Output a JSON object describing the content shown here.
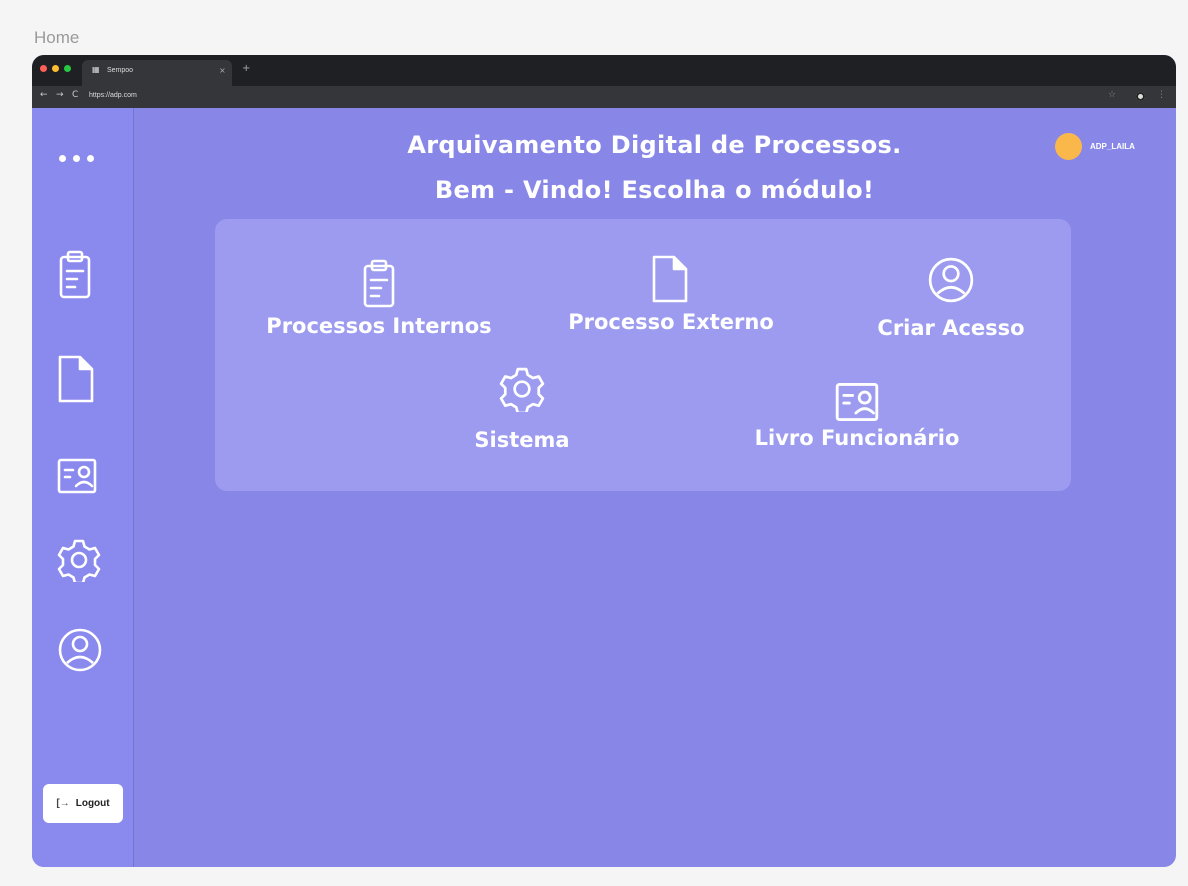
{
  "frame": {
    "label": "Home"
  },
  "browser": {
    "tab_title": "Sempoo",
    "tab_close": "×",
    "tab_new": "+",
    "url": "https://adp.com"
  },
  "header": {
    "title": "Arquivamento Digital de Processos.",
    "subtitle": "Bem - Vindo! Escolha o módulo!"
  },
  "user": {
    "name": "ADP_LAILA",
    "avatar_color": "#fbb84a"
  },
  "sidebar": {
    "items": [
      {
        "name": "clipboard-icon"
      },
      {
        "name": "document-icon"
      },
      {
        "name": "id-card-icon"
      },
      {
        "name": "gear-icon"
      },
      {
        "name": "user-circle-icon"
      }
    ],
    "logout_label": "Logout"
  },
  "modules": [
    {
      "label": "Processos Internos",
      "icon": "clipboard-icon"
    },
    {
      "label": "Processo Externo",
      "icon": "document-icon"
    },
    {
      "label": "Criar Acesso",
      "icon": "user-circle-icon"
    },
    {
      "label": "Sistema",
      "icon": "gear-icon"
    },
    {
      "label": "Livro Funcionário",
      "icon": "id-card-icon"
    }
  ],
  "colors": {
    "background": "#8887e8",
    "sidebar": "#8a89ee",
    "panel": "#9c9bef",
    "chrome": "#1f2023"
  }
}
